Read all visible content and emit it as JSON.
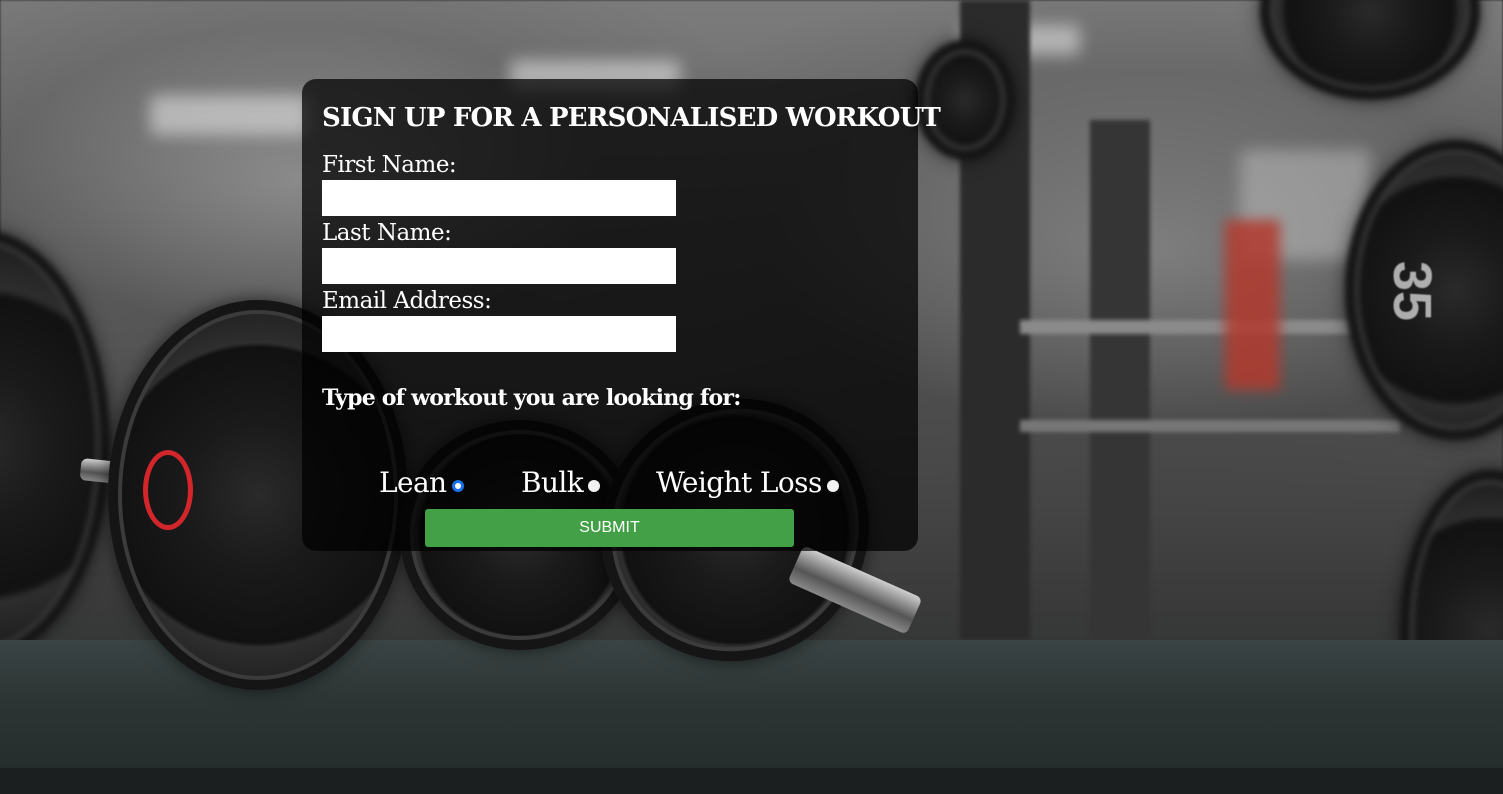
{
  "form": {
    "title": "SIGN UP FOR A PERSONALISED WORKOUT",
    "fields": {
      "first_name": {
        "label": "First Name:",
        "value": "",
        "placeholder": ""
      },
      "last_name": {
        "label": "Last Name:",
        "value": "",
        "placeholder": ""
      },
      "email": {
        "label": "Email Address:",
        "value": "",
        "placeholder": ""
      }
    },
    "workout_question": "Type of workout you are looking for:",
    "workout_options": [
      {
        "label": "Lean",
        "checked": true
      },
      {
        "label": "Bulk",
        "checked": false
      },
      {
        "label": "Weight Loss",
        "checked": false
      }
    ],
    "submit_label": "SUBMIT"
  },
  "background": {
    "plate_number": "35"
  },
  "colors": {
    "submit_button": "#43a047",
    "radio_selected": "#1a73e8",
    "card_overlay": "rgba(0,0,0,0.72)"
  }
}
